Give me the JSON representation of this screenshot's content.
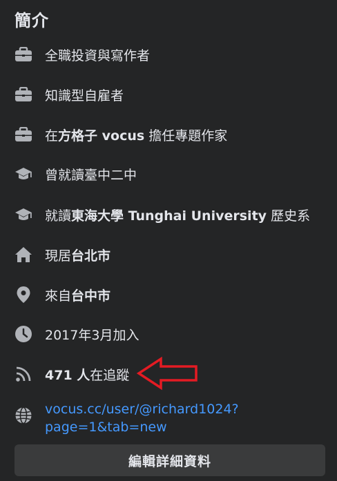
{
  "section_title": "簡介",
  "items": [
    {
      "icon": "briefcase-icon",
      "text": "全職投資與寫作者"
    },
    {
      "icon": "briefcase-icon",
      "text": "知識型自雇者"
    },
    {
      "icon": "briefcase-icon",
      "prefix": "在",
      "bold": "方格子 vocus",
      "suffix": " 擔任專題作家"
    },
    {
      "icon": "graduation-cap-icon",
      "text": "曾就讀臺中二中"
    },
    {
      "icon": "graduation-cap-icon",
      "prefix": "就讀",
      "bold": "東海大學 Tunghai University",
      "suffix": " 歷史系"
    },
    {
      "icon": "home-icon",
      "prefix": "現居",
      "bold": "台北市",
      "suffix": ""
    },
    {
      "icon": "location-pin-icon",
      "prefix": "來自",
      "bold": "台中市",
      "suffix": ""
    },
    {
      "icon": "clock-icon",
      "text": "2017年3月加入"
    },
    {
      "icon": "rss-icon",
      "prefix": "",
      "bold": "471 人",
      "suffix": "在追蹤"
    }
  ],
  "website": {
    "icon": "globe-icon",
    "line1": "vocus.cc/user/@richard1024?",
    "line2": "page=1&tab=new"
  },
  "edit_button_label": "編輯詳細資料",
  "colors": {
    "background": "#242526",
    "text": "#e4e6eb",
    "icon": "#b0b3b8",
    "link": "#4599ff",
    "button_bg": "#3a3b3c",
    "arrow": "#e41b23"
  }
}
